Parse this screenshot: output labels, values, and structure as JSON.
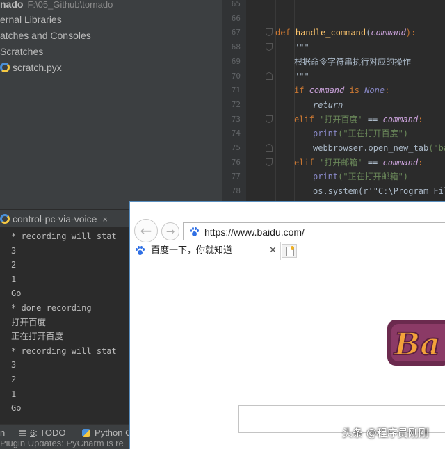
{
  "project_tree": {
    "rows": [
      {
        "bold": "nado",
        "muted": "F:\\05_Github\\tornado"
      },
      {
        "label": "ernal Libraries"
      },
      {
        "label": "atches and Consoles"
      },
      {
        "label": "Scratches"
      },
      {
        "label": "scratch.pyx"
      }
    ]
  },
  "editor": {
    "line_numbers": [
      "65",
      "66",
      "67",
      "68",
      "69",
      "70",
      "71",
      "72",
      "73",
      "74",
      "75",
      "76",
      "77",
      "78"
    ],
    "lines": {
      "l67_def": "def",
      "l67_name": "handle_command",
      "l67_open": "(",
      "l67_param": "command",
      "l67_close": "):",
      "l68": "\"\"\"",
      "l69": "根据命令字符串执行对应的操作",
      "l70": "\"\"\"",
      "l71_if": "if",
      "l71_var": "command",
      "l71_is": "is",
      "l71_none": "None",
      "l71_colon": ":",
      "l72": "return",
      "l73_elif": "elif",
      "l73_str": "'打开百度'",
      "l73_eq": "==",
      "l73_var": "command",
      "l73_colon": ":",
      "l74_print": "print",
      "l74_arg": "(\"正在打开百度\")",
      "l75_obj": "webbrowser.",
      "l75_fn": "open_new_tab",
      "l75_arg": "(\"baidu",
      "l76_elif": "elif",
      "l76_str": "'打开邮箱'",
      "l76_eq": "==",
      "l76_var": "command",
      "l76_colon": ":",
      "l77_print": "print",
      "l77_arg": "(\"正在打开邮箱\")",
      "l78": "os.system(r'\"C:\\Program Fil"
    }
  },
  "run_window": {
    "tab_label": "control-pc-via-voice",
    "tab_close": "×",
    "console_lines": [
      "* recording will stat",
      "3",
      "2",
      "1",
      "Go",
      "* done recording",
      "打开百度",
      "正在打开百度",
      "* recording will stat",
      "3",
      "2",
      "1",
      "Go"
    ]
  },
  "bottom_bar": {
    "item_left": "n",
    "todo_num": "6",
    "todo_label": ": TODO",
    "python_console": "Python C"
  },
  "status_bar": {
    "text": "Plugin Updates: PyCharm is re"
  },
  "browser": {
    "back_glyph": "←",
    "forward_glyph": "→",
    "url": "https://www.baidu.com/",
    "tab_title": "百度一下，你就知道",
    "tab_close": "✕",
    "logo_text": "Ba"
  },
  "watermark": {
    "text": "头条 @程序员刚刚"
  },
  "colors": {
    "editor_bg": "#2b2b2b",
    "panel_bg": "#3c3f41",
    "keyword": "#cc7832",
    "function": "#ffc66d",
    "string": "#6a8759",
    "browser_accent": "#2f6fe4"
  }
}
